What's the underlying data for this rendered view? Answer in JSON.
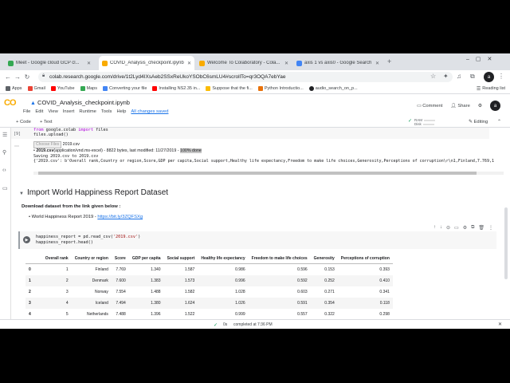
{
  "browser": {
    "tabs": [
      {
        "title": "Meet - Google cloud GCP cl...",
        "fav_color": "#34a853",
        "active": false
      },
      {
        "title": "COVID_Analysis_checkpoint.ipynb",
        "fav_color": "#f9ab00",
        "active": true
      },
      {
        "title": "Welcome To Colaboratory - Cola...",
        "fav_color": "#f9ab00",
        "active": false
      },
      {
        "title": "axis 1 vs axis0 - Google Search",
        "fav_color": "#4285f4",
        "active": false
      }
    ],
    "url": "colab.research.google.com/drive/1t2Lyd4IXsAeb2SSxReUkoYSObC6smLU4#scrollTo=qr3OQA7ebYae",
    "avatar_letter": "a"
  },
  "bookmarks": [
    {
      "label": "Apps",
      "color": "#5f6368"
    },
    {
      "label": "Gmail",
      "color": "#ea4335"
    },
    {
      "label": "YouTube",
      "color": "#ff0000"
    },
    {
      "label": "Maps",
      "color": "#34a853"
    },
    {
      "label": "Converting your file",
      "color": "#4285f4"
    },
    {
      "label": "Installing NS2.35 in...",
      "color": "#ff0000"
    },
    {
      "label": "Suppose that the fi...",
      "color": "#fbbc04"
    },
    {
      "label": "Python Introductio...",
      "color": "#e8710a"
    },
    {
      "label": "audio_search_on_p...",
      "color": "#202124"
    }
  ],
  "reading_list": "Reading list",
  "colab": {
    "logo": "CO",
    "notebook_name": "COVID_Analysis_checkpoint.ipynb",
    "menus": [
      "File",
      "Edit",
      "View",
      "Insert",
      "Runtime",
      "Tools",
      "Help"
    ],
    "saved_status": "All changes saved",
    "comment": "Comment",
    "share": "Share",
    "add_code": "+ Code",
    "add_text": "+ Text",
    "ram": "RAM",
    "disk": "Disk",
    "editing": "Editing"
  },
  "cell1": {
    "exec_count": "[9]",
    "line1_kw1": "from",
    "line1_rest": " google.colab ",
    "line1_kw2": "import",
    "line1_end": " files",
    "line2": "files.upload()"
  },
  "output1": {
    "choose_btn": "Choose Files",
    "chosen_file": "2019.csv",
    "file_bold": "2019.csv",
    "file_info": "(application/vnd.ms-excel) - 8822 bytes, last modified: 11/27/2019 - ",
    "file_done": "100% done",
    "saving": "Saving 2019.csv to 2019.csv",
    "dict": "{'2019.csv': b'Overall rank,Country or region,Score,GDP per capita,Social support,Healthy life expectancy,Freedom to make life choices,Generosity,Perceptions of corruption\\r\\n1,Finland,7.769,1"
  },
  "section": {
    "heading": "Import World Happiness Report Dataset",
    "subhead": "Download dataset from the link given below :",
    "bullet_text": "World Happiness Report 2019 - ",
    "bullet_link": "https://bit.ly/3ZQFSXg"
  },
  "cell2": {
    "line1_a": "happiness_report = pd.read_csv(",
    "line1_str": "'2019.csv'",
    "line1_b": ")",
    "line2": "happiness_report.head()"
  },
  "table": {
    "headers": [
      "",
      "Overall rank",
      "Country or region",
      "Score",
      "GDP per capita",
      "Social support",
      "Healthy life expectancy",
      "Freedom to make life choices",
      "Generosity",
      "Perceptions of corruption"
    ],
    "rows": [
      [
        "0",
        "1",
        "Finland",
        "7.769",
        "1.340",
        "1.587",
        "0.986",
        "0.596",
        "0.153",
        "0.393"
      ],
      [
        "1",
        "2",
        "Denmark",
        "7.600",
        "1.383",
        "1.573",
        "0.996",
        "0.592",
        "0.252",
        "0.410"
      ],
      [
        "2",
        "3",
        "Norway",
        "7.554",
        "1.488",
        "1.582",
        "1.028",
        "0.603",
        "0.271",
        "0.341"
      ],
      [
        "3",
        "4",
        "Iceland",
        "7.494",
        "1.380",
        "1.624",
        "1.026",
        "0.591",
        "0.354",
        "0.118"
      ],
      [
        "4",
        "5",
        "Netherlands",
        "7.488",
        "1.396",
        "1.522",
        "0.999",
        "0.557",
        "0.322",
        "0.298"
      ]
    ]
  },
  "status": {
    "secs": "0s",
    "done": "completed at 7:36 PM"
  }
}
